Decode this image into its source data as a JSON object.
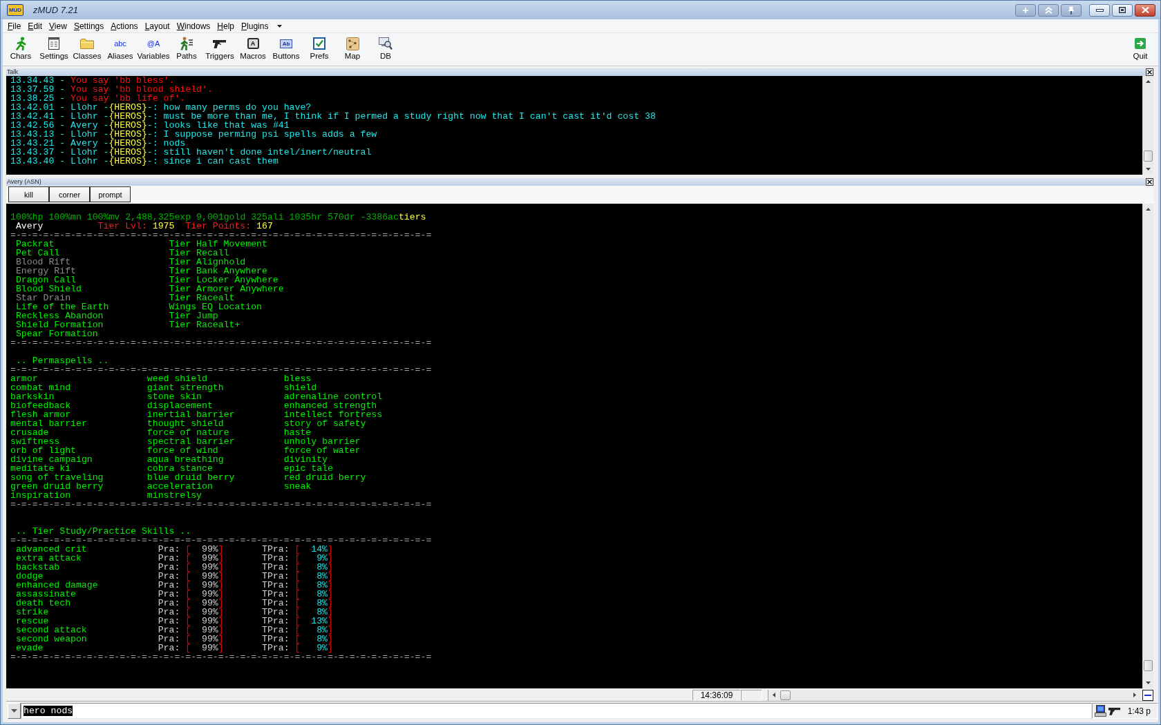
{
  "window": {
    "title": "zMUD 7.21",
    "logo_text": "MUD"
  },
  "menu": [
    "File",
    "Edit",
    "View",
    "Settings",
    "Actions",
    "Layout",
    "Windows",
    "Help",
    "Plugins"
  ],
  "toolbar": {
    "items": [
      {
        "label": "Chars",
        "kind": "runner"
      },
      {
        "label": "Settings",
        "kind": "form"
      },
      {
        "label": "Classes",
        "kind": "folder"
      },
      {
        "label": "Aliases",
        "kind": "letters",
        "glyph": "abc"
      },
      {
        "label": "Variables",
        "kind": "letters",
        "glyph": "@A"
      },
      {
        "label": "Paths",
        "kind": "walker"
      },
      {
        "label": "Triggers",
        "kind": "gun"
      },
      {
        "label": "Macros",
        "kind": "key",
        "glyph": "A"
      },
      {
        "label": "Buttons",
        "kind": "tag",
        "glyph": "Ab"
      },
      {
        "label": "Prefs",
        "kind": "check"
      },
      {
        "label": "Map",
        "kind": "map"
      },
      {
        "label": "DB",
        "kind": "db"
      }
    ],
    "quit": {
      "label": "Quit"
    }
  },
  "talk": {
    "title": "Talk",
    "lines": [
      {
        "segments": [
          {
            "text": "13.34.43 - ",
            "color": "#20e8e8"
          },
          {
            "text": "You say 'bb bless'.",
            "color": "#ff1010"
          }
        ]
      },
      {
        "segments": [
          {
            "text": "13.37.59 - ",
            "color": "#20e8e8"
          },
          {
            "text": "You say 'bb blood shield'.",
            "color": "#ff1010"
          }
        ]
      },
      {
        "segments": [
          {
            "text": "13.38.25 - ",
            "color": "#20e8e8"
          },
          {
            "text": "You say 'bb life of'.",
            "color": "#ff1010"
          }
        ]
      },
      {
        "segments": [
          {
            "text": "13.42.01 - Llohr -",
            "color": "#20e8e8"
          },
          {
            "text": "{HEROS}",
            "color": "#ffff40"
          },
          {
            "text": "-: how many perms do you have?",
            "color": "#20e8e8"
          }
        ]
      },
      {
        "segments": [
          {
            "text": "13.42.41 - Llohr -",
            "color": "#20e8e8"
          },
          {
            "text": "{HEROS}",
            "color": "#ffff40"
          },
          {
            "text": "-: must be more than me, I think if I permed a study right now that I can't cast it'd cost 38",
            "color": "#20e8e8"
          }
        ]
      },
      {
        "segments": [
          {
            "text": "13.42.56 - Avery -",
            "color": "#20e8e8"
          },
          {
            "text": "{HEROS}",
            "color": "#ffff40"
          },
          {
            "text": "-: looks like that was #41",
            "color": "#20e8e8"
          }
        ]
      },
      {
        "segments": [
          {
            "text": "13.43.13 - Llohr -",
            "color": "#20e8e8"
          },
          {
            "text": "{HEROS}",
            "color": "#ffff40"
          },
          {
            "text": "-: I suppose perming psi spells adds a few",
            "color": "#20e8e8"
          }
        ]
      },
      {
        "segments": [
          {
            "text": "13.43.21 - Avery -",
            "color": "#20e8e8"
          },
          {
            "text": "{HEROS}",
            "color": "#ffff40"
          },
          {
            "text": "-: nods",
            "color": "#20e8e8"
          }
        ]
      },
      {
        "segments": [
          {
            "text": "13.43.37 - Llohr -",
            "color": "#20e8e8"
          },
          {
            "text": "{HEROS}",
            "color": "#ffff40"
          },
          {
            "text": "-: still haven't done intel/inert/neutral",
            "color": "#20e8e8"
          }
        ]
      },
      {
        "segments": [
          {
            "text": "13.43.40 - Llohr -",
            "color": "#20e8e8"
          },
          {
            "text": "{HEROS}",
            "color": "#ffff40"
          },
          {
            "text": "-: since i can cast them",
            "color": "#20e8e8"
          }
        ]
      }
    ]
  },
  "session": {
    "title": "Avery (ASN)",
    "buttons": [
      "kill",
      "corner",
      "prompt"
    ],
    "status_line": [
      {
        "text": "100%hp 100%mn 100%mv 2,488,325exp 9,001gold 325ali 1035hr 570dr -3386ac",
        "color": "#00b400"
      },
      {
        "text": "tiers",
        "color": "#ffff40"
      }
    ],
    "character": {
      "name": "Avery",
      "tier_lvl_label": "Tier Lvl:",
      "tier_lvl": "1975",
      "tier_points_label": "Tier Points:",
      "tier_points": "167"
    },
    "abilities": {
      "rule_top": "=-=-=-=-=-=-=-=-=-=-=-=-=-=-=-=-=-=-=-=-=-=-=-=-=-=-=-=-=-=-=-=-=-=-=-=-=-=-=",
      "rows": [
        [
          {
            "text": "Packrat",
            "color": "#00f000"
          },
          {
            "text": "Tier Half Movement",
            "color": "#00f000"
          }
        ],
        [
          {
            "text": "Pet Call",
            "color": "#00f000"
          },
          {
            "text": "Tier Recall",
            "color": "#00f000"
          }
        ],
        [
          {
            "text": "Blood Rift",
            "color": "#8c8c8c"
          },
          {
            "text": "Tier Alignhold",
            "color": "#00f000"
          }
        ],
        [
          {
            "text": "Energy Rift",
            "color": "#8c8c8c"
          },
          {
            "text": "Tier Bank Anywhere",
            "color": "#00f000"
          }
        ],
        [
          {
            "text": "Dragon Call",
            "color": "#00f000"
          },
          {
            "text": "Tier Locker Anywhere",
            "color": "#00f000"
          }
        ],
        [
          {
            "text": "Blood Shield",
            "color": "#00f000"
          },
          {
            "text": "Tier Armorer Anywhere",
            "color": "#00f000"
          }
        ],
        [
          {
            "text": "Star Drain",
            "color": "#8c8c8c"
          },
          {
            "text": "Tier Racealt",
            "color": "#00f000"
          }
        ],
        [
          {
            "text": "Life of the Earth",
            "color": "#00f000"
          },
          {
            "text": "Wings EQ Location",
            "color": "#00f000"
          }
        ],
        [
          {
            "text": "Reckless Abandon",
            "color": "#00f000"
          },
          {
            "text": "Tier Jump",
            "color": "#00f000"
          }
        ],
        [
          {
            "text": "Shield Formation",
            "color": "#00f000"
          },
          {
            "text": "Tier Racealt+",
            "color": "#00f000"
          }
        ],
        [
          {
            "text": "Spear Formation",
            "color": "#00f000"
          }
        ]
      ],
      "rule_bottom": "=-=-=-=-=-=-=-=-=-=-=-=-=-=-=-=-=-=-=-=-=-=-=-=-=-=-=-=-=-=-=-=-=-=-=-=-=-=-="
    },
    "permaspells": {
      "heading": ".. Permaspells ..",
      "rule_top": "=-=-=-=-=-=-=-=-=-=-=-=-=-=-=-=-=-=-=-=-=-=-=-=-=-=-=-=-=-=-=-=-=-=-=-=-=-=-=",
      "rows": [
        [
          "armor",
          "weed shield",
          "bless"
        ],
        [
          "combat mind",
          "giant strength",
          "shield"
        ],
        [
          "barkskin",
          "stone skin",
          "adrenaline control"
        ],
        [
          "biofeedback",
          "displacement",
          "enhanced strength"
        ],
        [
          "flesh armor",
          "inertial barrier",
          "intellect fortress"
        ],
        [
          "mental barrier",
          "thought shield",
          "story of safety"
        ],
        [
          "crusade",
          "force of nature",
          "haste"
        ],
        [
          "swiftness",
          "spectral barrier",
          "unholy barrier"
        ],
        [
          "orb of light",
          "force of wind",
          "force of water"
        ],
        [
          "divine campaign",
          "aqua breathing",
          "divinity"
        ],
        [
          "meditate ki",
          "cobra stance",
          "epic tale"
        ],
        [
          "song of traveling",
          "blue druid berry",
          "red druid berry"
        ],
        [
          "green druid berry",
          "acceleration",
          "sneak"
        ],
        [
          "inspiration",
          "minstrelsy"
        ]
      ],
      "rule_bottom": "=-=-=-=-=-=-=-=-=-=-=-=-=-=-=-=-=-=-=-=-=-=-=-=-=-=-=-=-=-=-=-=-=-=-=-=-=-=-="
    },
    "tier_skills": {
      "heading": ".. Tier Study/Practice Skills ..",
      "rule_top": "=-=-=-=-=-=-=-=-=-=-=-=-=-=-=-=-=-=-=-=-=-=-=-=-=-=-=-=-=-=-=-=-=-=-=-=-=-=-=",
      "rows": [
        {
          "name": "advanced crit",
          "pra_label": "Pra:",
          "pra": "[  99%]",
          "tpra_label": "TPra:",
          "tpra": "[  14%]"
        },
        {
          "name": "extra attack",
          "pra_label": "Pra:",
          "pra": "[  99%]",
          "tpra_label": "TPra:",
          "tpra": "[   9%]"
        },
        {
          "name": "backstab",
          "pra_label": "Pra:",
          "pra": "[  99%]",
          "tpra_label": "TPra:",
          "tpra": "[   8%]"
        },
        {
          "name": "dodge",
          "pra_label": "Pra:",
          "pra": "[  99%]",
          "tpra_label": "TPra:",
          "tpra": "[   8%]"
        },
        {
          "name": "enhanced damage",
          "pra_label": "Pra:",
          "pra": "[  99%]",
          "tpra_label": "TPra:",
          "tpra": "[   8%]"
        },
        {
          "name": "assassinate",
          "pra_label": "Pra:",
          "pra": "[  99%]",
          "tpra_label": "TPra:",
          "tpra": "[   8%]"
        },
        {
          "name": "death tech",
          "pra_label": "Pra:",
          "pra": "[  99%]",
          "tpra_label": "TPra:",
          "tpra": "[   8%]"
        },
        {
          "name": "strike",
          "pra_label": "Pra:",
          "pra": "[  99%]",
          "tpra_label": "TPra:",
          "tpra": "[   8%]"
        },
        {
          "name": "rescue",
          "pra_label": "Pra:",
          "pra": "[  99%]",
          "tpra_label": "TPra:",
          "tpra": "[  13%]"
        },
        {
          "name": "second attack",
          "pra_label": "Pra:",
          "pra": "[  99%]",
          "tpra_label": "TPra:",
          "tpra": "[   8%]"
        },
        {
          "name": "second weapon",
          "pra_label": "Pra:",
          "pra": "[  99%]",
          "tpra_label": "TPra:",
          "tpra": "[   8%]"
        },
        {
          "name": "evade",
          "pra_label": "Pra:",
          "pra": "[  99%]",
          "tpra_label": "TPra:",
          "tpra": "[   9%]"
        }
      ],
      "rule_bottom": "=-=-=-=-=-=-=-=-=-=-=-=-=-=-=-=-=-=-=-=-=-=-=-=-=-=-=-=-=-=-=-=-=-=-=-=-=-=-="
    }
  },
  "status_bar": {
    "time": "14:36:09"
  },
  "command": {
    "value": "hero nods",
    "selected": true
  },
  "tray": {
    "time": "1:43 p"
  }
}
